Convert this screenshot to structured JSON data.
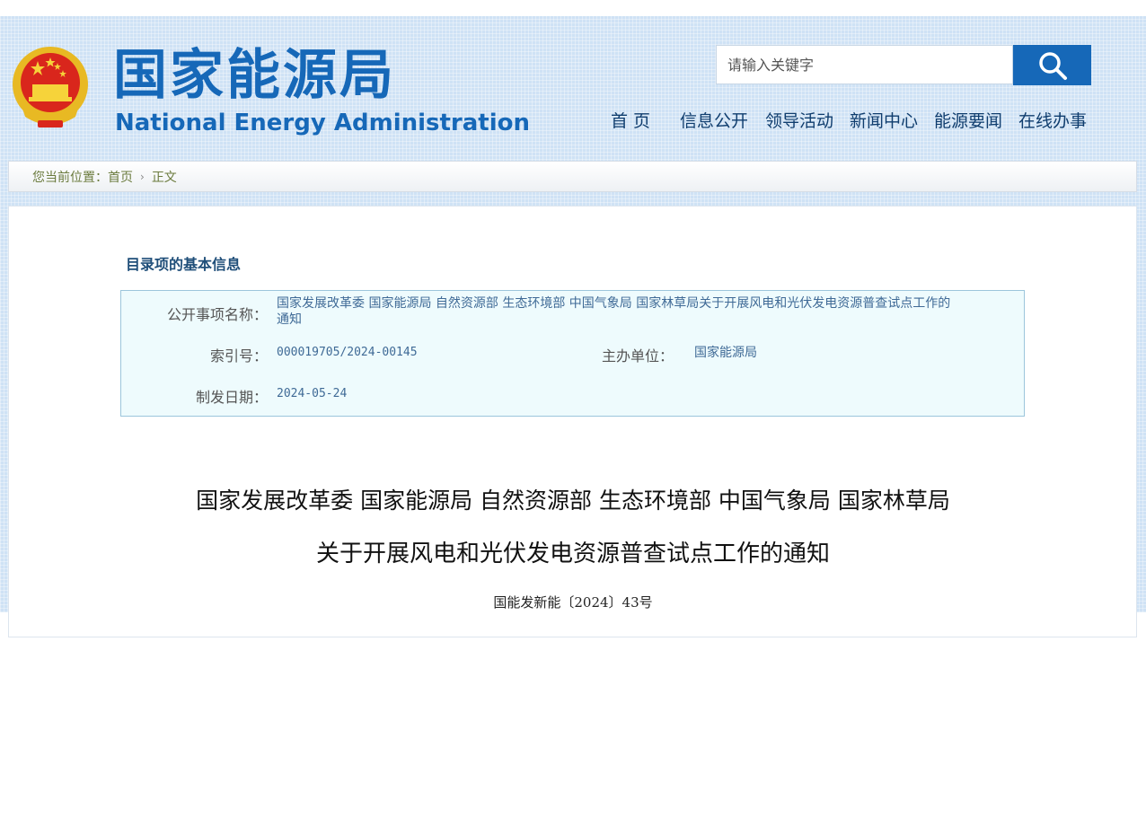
{
  "header": {
    "brand_cn": "国家能源局",
    "brand_en": "National Energy Administration",
    "search_placeholder": "请输入关键字",
    "nav": [
      "首 页",
      "信息公开",
      "领导活动",
      "新闻中心",
      "能源要闻",
      "在线办事"
    ]
  },
  "breadcrumb": {
    "prefix": "您当前位置：",
    "home": "首页",
    "current": "正文"
  },
  "metadata": {
    "section_title": "目录项的基本信息",
    "name_label": "公开事项名称：",
    "name_value_line1": "国家发展改革委 国家能源局 自然资源部 生态环境部 中国气象局 国家林草局关于开展风电和光伏发电资源普查试点工作的",
    "name_value_line2": "通知",
    "index_label": "索引号：",
    "index_value": "000019705/2024-00145",
    "org_label": "主办单位：",
    "org_value": "国家能源局",
    "date_label": "制发日期：",
    "date_value": "2024-05-24"
  },
  "document": {
    "title_line1": "国家发展改革委 国家能源局 自然资源部 生态环境部 中国气象局 国家林草局",
    "title_line2": "关于开展风电和光伏发电资源普查试点工作的通知",
    "number": "国能发新能〔2024〕43号"
  },
  "colors": {
    "brand_blue": "#1668b8",
    "band_blue": "#cfe2f5",
    "meta_bg": "#eefbfd",
    "meta_border": "#9cc6dc"
  },
  "icons": {
    "search": "search-icon",
    "emblem": "national-emblem-icon",
    "chevron": "chevron-right-icon"
  }
}
